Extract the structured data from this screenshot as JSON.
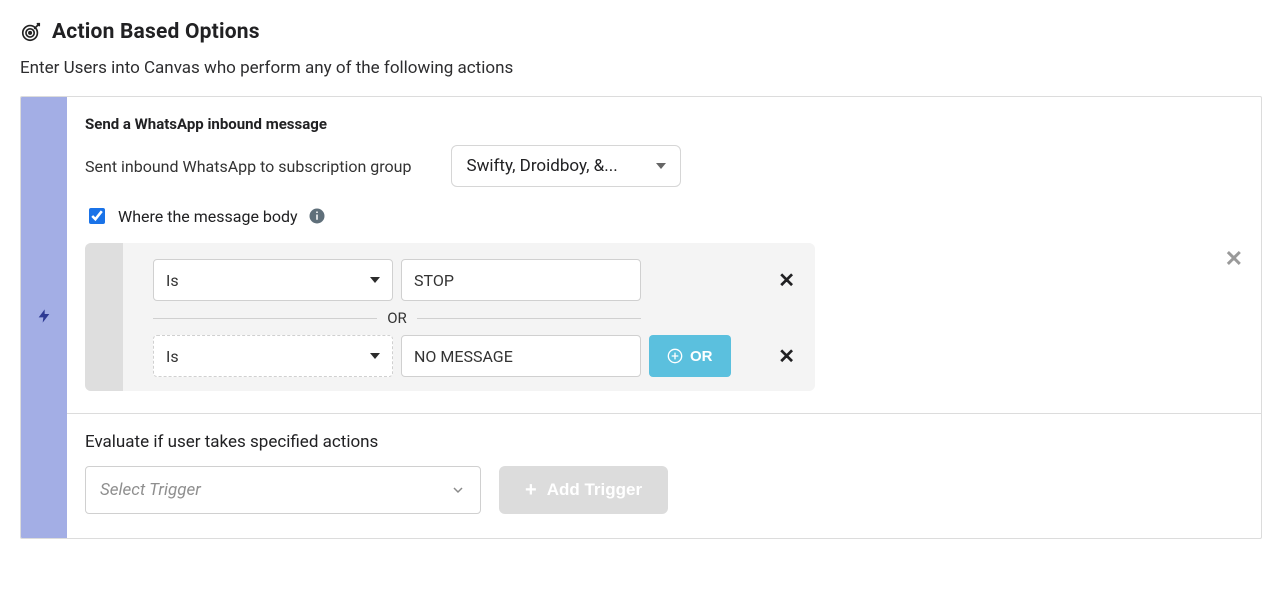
{
  "header": {
    "title": "Action Based Options",
    "subtitle": "Enter Users into Canvas who perform any of the following actions"
  },
  "card": {
    "title": "Send a WhatsApp inbound message",
    "subscription_label": "Sent inbound WhatsApp to subscription group",
    "subscription_group_value": "Swifty, Droidboy, &...",
    "checkbox_label": "Where the message body",
    "checkbox_checked": true,
    "conditions": {
      "rows": [
        {
          "operator": "Is",
          "value": "STOP"
        },
        {
          "operator": "Is",
          "value": "NO MESSAGE"
        }
      ],
      "separator": "OR",
      "or_button": "OR"
    }
  },
  "evaluate": {
    "label": "Evaluate if user takes specified actions",
    "select_placeholder": "Select Trigger",
    "add_button": "Add Trigger"
  }
}
